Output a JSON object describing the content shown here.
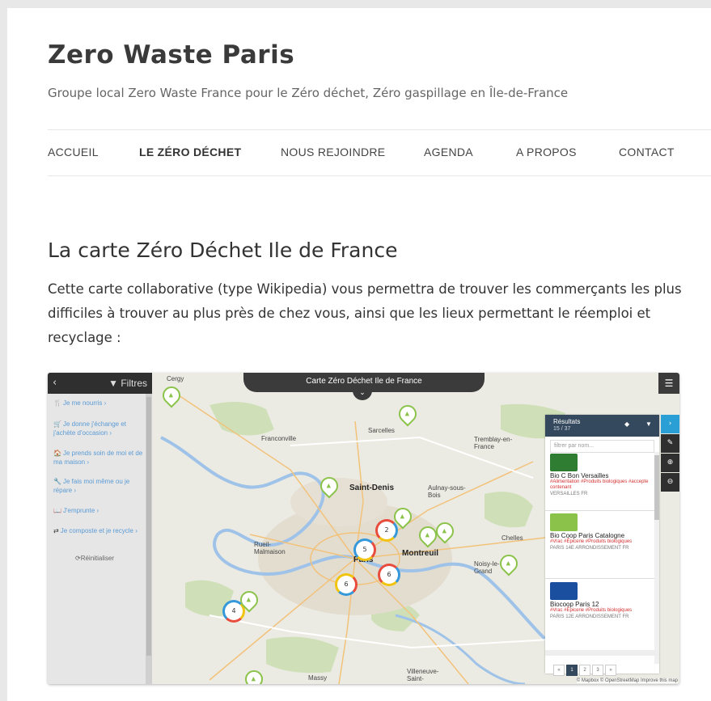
{
  "site": {
    "title": "Zero Waste Paris",
    "tagline": "Groupe local Zero Waste France pour le Zéro déchet, Zéro gaspillage en Île-de-France"
  },
  "nav": {
    "items": [
      {
        "label": "ACCUEIL",
        "active": false
      },
      {
        "label": "LE ZÉRO DÉCHET",
        "active": true
      },
      {
        "label": "NOUS REJOINDRE",
        "active": false
      },
      {
        "label": "AGENDA",
        "active": false
      },
      {
        "label": "A PROPOS",
        "active": false
      },
      {
        "label": "CONTACT",
        "active": false
      }
    ]
  },
  "page": {
    "title": "La carte Zéro Déchet Ile de France",
    "intro": "Cette carte collaborative (type Wikipedia) vous permettra de trouver les commerçants les plus difficiles à trouver au plus près de chez vous, ainsi que les lieux permettant le réemploi et recyclage :"
  },
  "map": {
    "title": "Carte Zéro Déchet Ile de France",
    "filters": {
      "title": "Filtres",
      "back": "‹",
      "items": [
        {
          "icon": "🍴",
          "label": "Je me nourris ›"
        },
        {
          "icon": "🛒",
          "label": "Je donne j'échange et j'achète d'occasion ›"
        },
        {
          "icon": "🏠",
          "label": "Je prends soin de moi et de ma maison ›"
        },
        {
          "icon": "🔧",
          "label": "Je fais moi même ou je répare ›"
        },
        {
          "icon": "📖",
          "label": "J'emprunte ›"
        },
        {
          "icon": "⇄",
          "label": "Je composte et je recycle ›"
        }
      ],
      "reset": "⟳Réinitialiser"
    },
    "results": {
      "title": "Résultats",
      "count": "15 / 37",
      "filter_placeholder": "filtrer par nom...",
      "items": [
        {
          "name": "Bio C Bon Versailles",
          "tags": "#Alimentation #Produits biologiques #accepte contenant",
          "address": "VERSAILLES FR"
        },
        {
          "name": "Bio Coop Paris Catalogne",
          "tags": "#Vrac #Épicerie #Produits biologiques",
          "address": "PARIS 14E ARRONDISSEMENT FR"
        },
        {
          "name": "Biocoop Paris 12",
          "tags": "#Vrac #Épicerie #Produits biologiques",
          "address": "PARIS 12E ARRONDISSEMENT FR"
        }
      ],
      "pages": [
        "«",
        "1",
        "2",
        "3",
        "»"
      ]
    },
    "places": [
      "Cergy",
      "Franconville",
      "Sarcelles",
      "Tremblay-en-France",
      "Saint-Denis",
      "Aulnay-sous-Bois",
      "Rueil-Malmaison",
      "Paris",
      "Montreuil",
      "Chelles",
      "Noisy-le-Grand",
      "Massy",
      "Villeneuve-Saint-"
    ],
    "clusters": [
      "2",
      "5",
      "6",
      "6",
      "4"
    ],
    "attribution": "© Mapbox © OpenStreetMap Improve this map"
  }
}
